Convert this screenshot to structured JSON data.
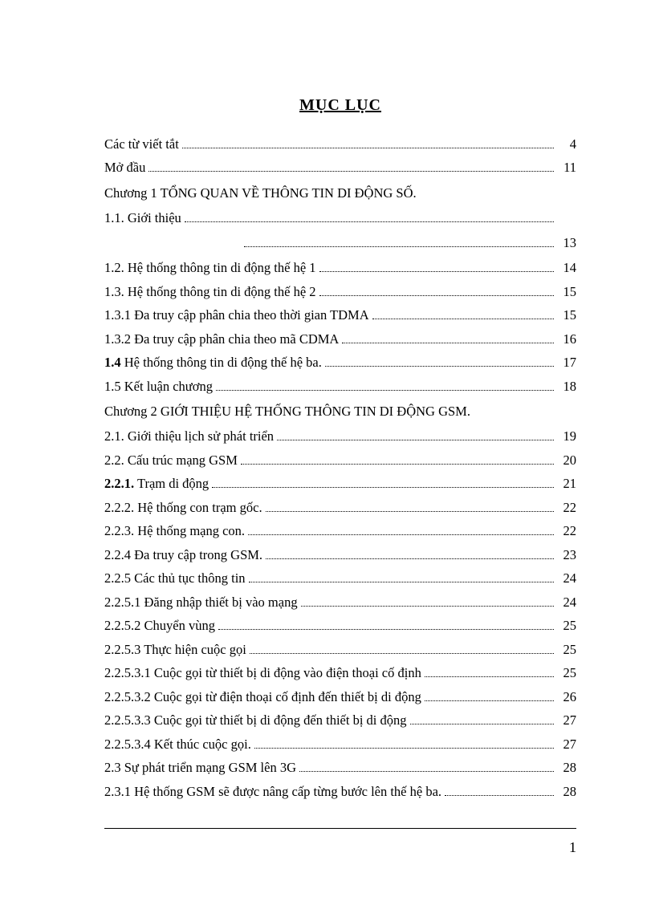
{
  "title": "MỤC LỤC",
  "page_number": "1",
  "entries": [
    {
      "kind": "row",
      "label": "Các từ viết tắt",
      "page": "4",
      "leader": true
    },
    {
      "kind": "row",
      "label": "Mở đầu ",
      "page": "11",
      "leader": true
    },
    {
      "kind": "chapter",
      "label": "Chương 1  TỔNG QUAN VỀ THÔNG TIN DI ĐỘNG  SỐ."
    },
    {
      "kind": "row",
      "label": "1.1.   Giới thiệu",
      "page": "",
      "leader": true
    },
    {
      "kind": "continuation",
      "page": "13",
      "leader": true
    },
    {
      "kind": "row",
      "label": "1.2.   Hệ thống thông tin di động  thế hệ 1 ",
      "page": "14",
      "leader": true
    },
    {
      "kind": "row",
      "label": "1.3.   Hệ thống thông tin di động  thế hệ 2 ",
      "page": "15",
      "leader": true
    },
    {
      "kind": "row",
      "label": "1.3.1   Đa truy cập  phân  chia theo  thời  gian TDMA ",
      "page": "15",
      "leader": true
    },
    {
      "kind": "row",
      "label": "1.3.2   Đa truy cập  phân  chia theo   mã  CDMA ",
      "page": "16",
      "leader": true
    },
    {
      "kind": "row",
      "bold_prefix": "1.4",
      "label_rest": "    Hệ thống thông tin di động thế hệ ba.",
      "page": "17",
      "leader": true
    },
    {
      "kind": "row",
      "label": "1.5    Kết luận chương",
      "page": "18",
      "leader": true
    },
    {
      "kind": "chapter",
      "label": "Chương 2  GIỚI THIỆU HỆ THỐNG  THÔNG TIN DI ĐỘNG GSM."
    },
    {
      "kind": "row",
      "label": "2.1.   Giới thiệu lịch sử phát triển ",
      "page": "19",
      "leader": true
    },
    {
      "kind": "row",
      "label": "2.2.   Cấu trúc mạng GSM ",
      "page": "20",
      "leader": true
    },
    {
      "kind": "row",
      "bold_prefix": "2.2.1.",
      "label_rest": "   Trạm di động ",
      "page": "21",
      "leader": true
    },
    {
      "kind": "row",
      "label": "2.2.2.   Hệ thống con trạm gốc.",
      "page": "22",
      "leader": true
    },
    {
      "kind": "row",
      "label": "2.2.3.   Hệ thống mạng  con.",
      "page": "22",
      "leader": true
    },
    {
      "kind": "row",
      "label": "2.2.4   Đa truy cập trong GSM. ",
      "page": "23",
      "leader": true
    },
    {
      "kind": "row",
      "label": "2.2.5    Các thủ tục thông tin",
      "page": "24",
      "leader": true
    },
    {
      "kind": "row",
      "label": "2.2.5.1    Đăng nhập thiết bị vào mạng ",
      "page": "24",
      "leader": true
    },
    {
      "kind": "row",
      "label": "2.2.5.2    Chuyển vùng ",
      "page": "25",
      "leader": true
    },
    {
      "kind": "row",
      "label": "2.2.5.3    Thực hiện cuộc gọi ",
      "page": "25",
      "leader": true
    },
    {
      "kind": "row",
      "label": "2.2.5.3.1    Cuộc gọi từ thiết bị di động vào điện thoại cố định",
      "page": "25",
      "leader": true
    },
    {
      "kind": "row",
      "label": "2.2.5.3.2    Cuộc gọi từ điện thoại cố định đến thiết bị di động",
      "page": "26",
      "leader": true
    },
    {
      "kind": "row",
      "label": "2.2.5.3.3  Cuộc gọi từ thiết bị di động đến thiết bị di động",
      "page": "27",
      "leader": true
    },
    {
      "kind": "row",
      "label": "2.2.5.3.4    Kết thúc cuộc gọi.",
      "page": "27",
      "leader": true
    },
    {
      "kind": "row",
      "label": "2.3    Sự phát triển mạng  GSM lên 3G ",
      "page": "28",
      "leader": true
    },
    {
      "kind": "row",
      "label": "2.3.1    Hệ thống GSM sẽ được nâng cấp từng bước lên thế hệ ba.",
      "page": "28",
      "leader": true
    }
  ]
}
